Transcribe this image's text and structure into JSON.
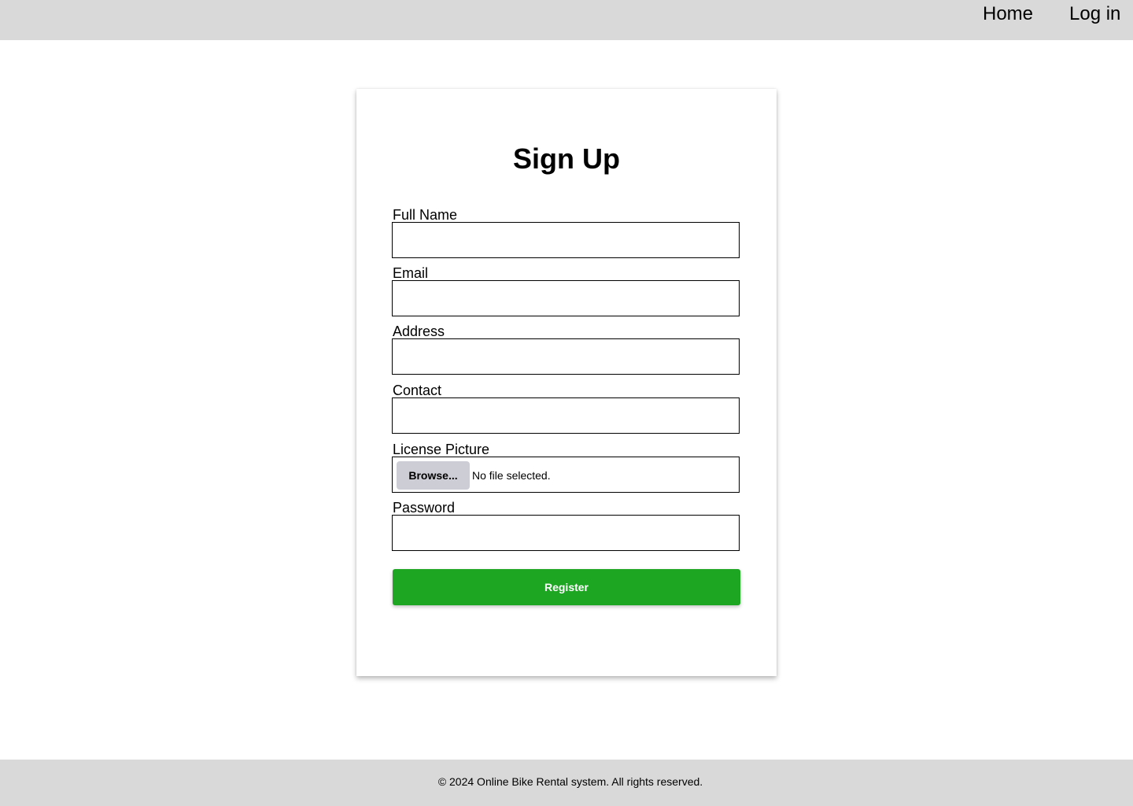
{
  "nav": {
    "home_label": "Home",
    "login_label": "Log in"
  },
  "form": {
    "title": "Sign Up",
    "fields": {
      "full_name": {
        "label": "Full Name",
        "value": ""
      },
      "email": {
        "label": "Email",
        "value": ""
      },
      "address": {
        "label": "Address",
        "value": ""
      },
      "contact": {
        "label": "Contact",
        "value": ""
      },
      "license_picture": {
        "label": "License Picture",
        "browse_label": "Browse...",
        "status": "No file selected."
      },
      "password": {
        "label": "Password",
        "value": ""
      }
    },
    "register_label": "Register"
  },
  "footer": {
    "text": "© 2024 Online Bike Rental system. All rights reserved."
  },
  "colors": {
    "bar_background": "#d9d9d9",
    "register_button": "#1ca622",
    "browse_button": "#cdcdd6"
  }
}
